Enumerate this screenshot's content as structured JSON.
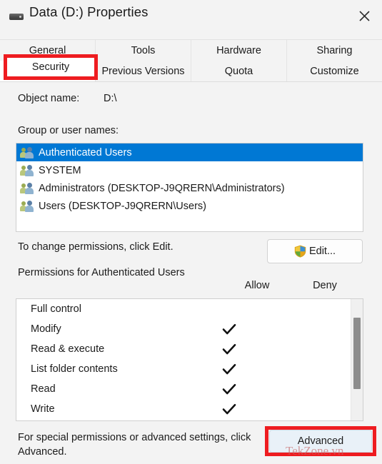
{
  "window": {
    "title": "Data (D:) Properties",
    "drive_icon": "hard-drive-icon",
    "close_icon": "close-icon"
  },
  "tabs": {
    "row1": [
      {
        "label": "General",
        "selected": false
      },
      {
        "label": "Tools",
        "selected": false
      },
      {
        "label": "Hardware",
        "selected": false
      },
      {
        "label": "Sharing",
        "selected": false
      }
    ],
    "row2": [
      {
        "label": "Security",
        "selected": true
      },
      {
        "label": "Previous Versions",
        "selected": false
      },
      {
        "label": "Quota",
        "selected": false
      },
      {
        "label": "Customize",
        "selected": false
      }
    ]
  },
  "security": {
    "object_name_label": "Object name:",
    "object_name_value": "D:\\",
    "group_label": "Group or user names:",
    "groups": [
      {
        "name": "Authenticated Users",
        "selected": true
      },
      {
        "name": "SYSTEM",
        "selected": false
      },
      {
        "name": "Administrators (DESKTOP-J9QRERN\\Administrators)",
        "selected": false
      },
      {
        "name": "Users (DESKTOP-J9QRERN\\Users)",
        "selected": false
      }
    ],
    "edit_hint": "To change permissions, click Edit.",
    "edit_label": "Edit...",
    "edit_shield_icon": "uac-shield-icon",
    "permissions_title": "Permissions for Authenticated Users",
    "allow_header": "Allow",
    "deny_header": "Deny",
    "permissions": [
      {
        "name": "Full control",
        "allow": false,
        "deny": false
      },
      {
        "name": "Modify",
        "allow": true,
        "deny": false
      },
      {
        "name": "Read & execute",
        "allow": true,
        "deny": false
      },
      {
        "name": "List folder contents",
        "allow": true,
        "deny": false
      },
      {
        "name": "Read",
        "allow": true,
        "deny": false
      },
      {
        "name": "Write",
        "allow": true,
        "deny": false
      }
    ],
    "advanced_hint": "For special permissions or advanced settings, click Advanced.",
    "advanced_label": "Advanced"
  },
  "annotations": {
    "highlight_color": "#ee1c20",
    "watermark": "TekZone.vn"
  },
  "colors": {
    "selection_blue": "#0078d4",
    "window_background": "#f3f3f3",
    "advanced_button_fill": "#e9f1f8"
  }
}
